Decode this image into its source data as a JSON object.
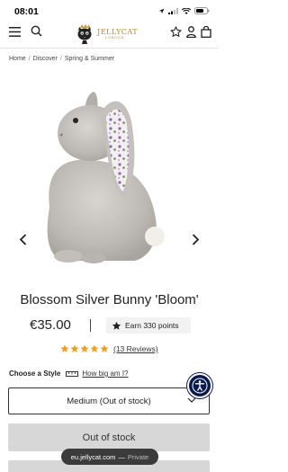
{
  "status_bar": {
    "time": "08:01"
  },
  "header": {
    "logo_text": "JELLYCAT",
    "logo_subtext": "LONDON"
  },
  "breadcrumb": {
    "items": [
      "Home",
      "Discover",
      "Spring & Summer"
    ],
    "separator": "/"
  },
  "product": {
    "title": "Blossom Silver Bunny 'Bloom'",
    "price": "€35.00",
    "points_label": "Earn 330 points",
    "rating": 5,
    "reviews_label": "(13 Reviews)",
    "star_color": "#f0a020"
  },
  "style": {
    "label": "Choose a Style",
    "size_link": "How big am I?",
    "selected_option": "Medium (Out of stock)"
  },
  "buttons": {
    "out_of_stock": "Out of stock"
  },
  "browser": {
    "url": "eu.jellycat.com",
    "separator": "—",
    "mode": "Private"
  },
  "colors": {
    "accent_gold": "#b08a2e",
    "accessibility_bg": "#0a1a4f"
  }
}
